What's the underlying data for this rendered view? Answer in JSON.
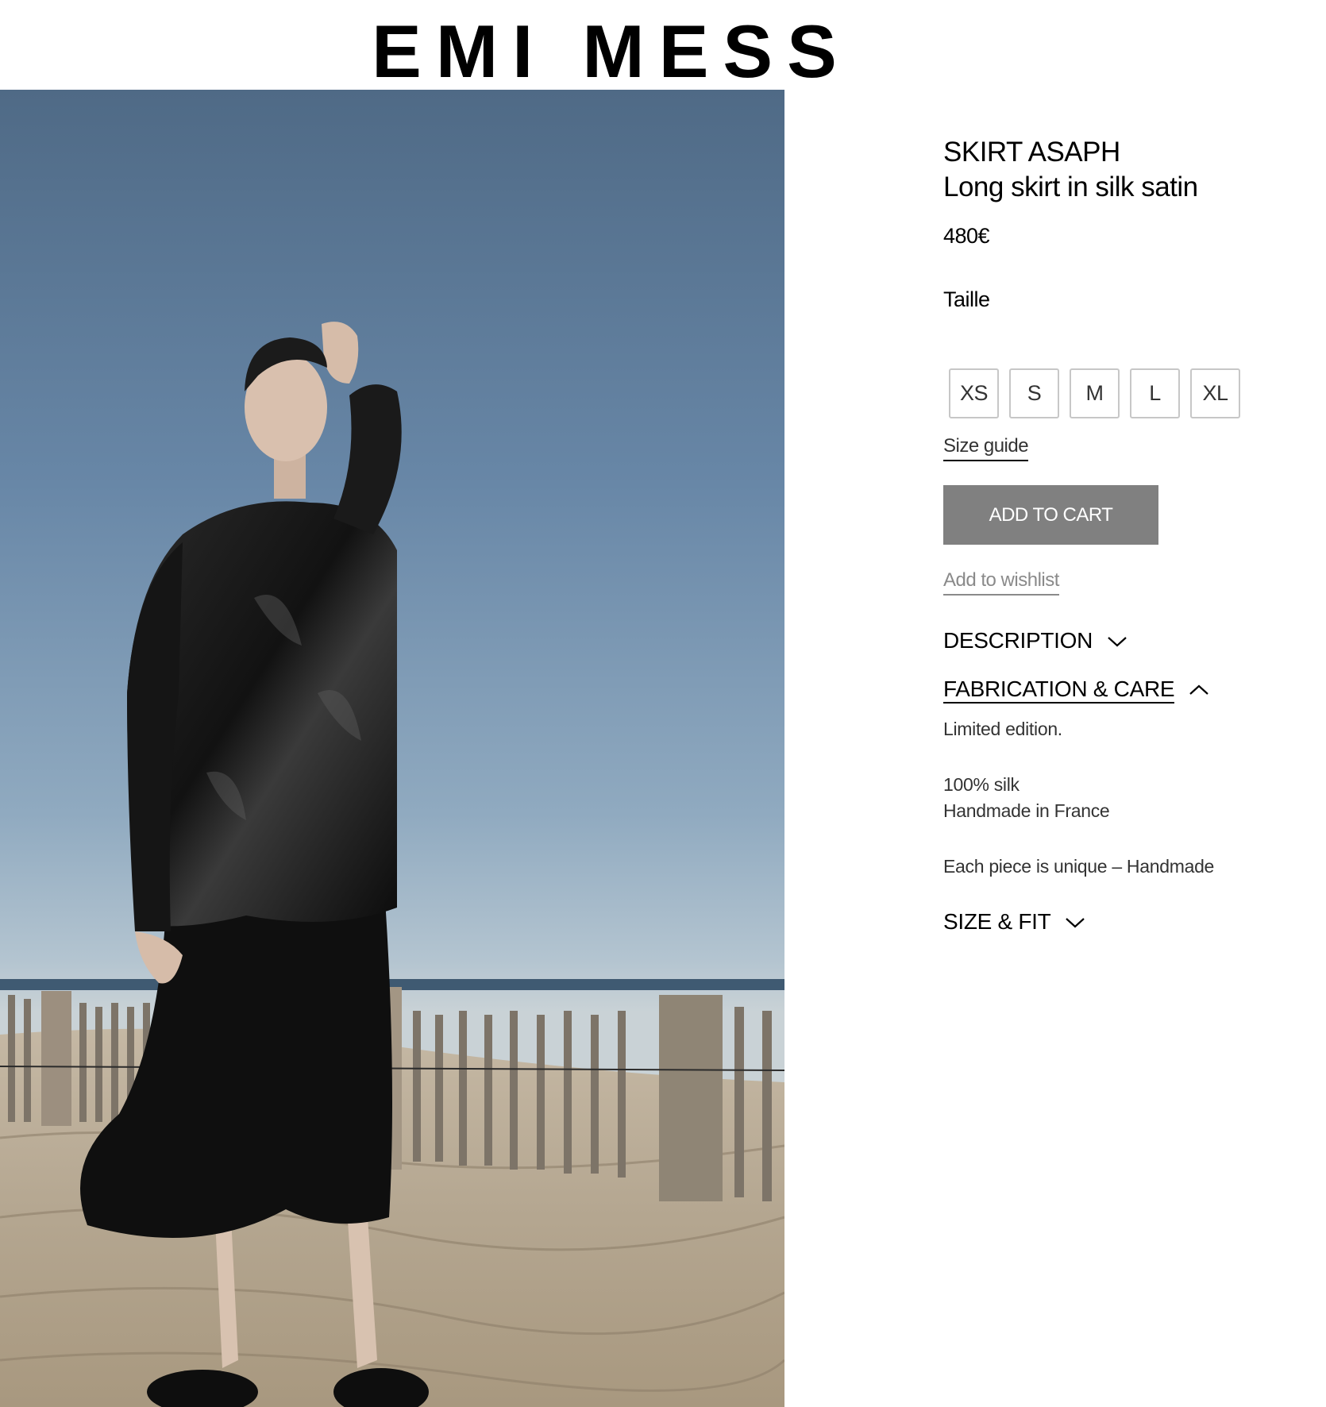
{
  "header": {
    "logo": "EMI MESS"
  },
  "product": {
    "name": "SKIRT ASAPH",
    "subtitle": "Long skirt in silk satin",
    "price": "480€",
    "size_label": "Taille",
    "sizes": [
      "XS",
      "S",
      "M",
      "L",
      "XL"
    ],
    "size_guide": "Size guide",
    "add_to_cart": "ADD TO CART",
    "wishlist": "Add to wishlist"
  },
  "accordion": {
    "description": {
      "title": "DESCRIPTION",
      "expanded": false
    },
    "fabrication": {
      "title": "FABRICATION & CARE",
      "expanded": true,
      "line1": "Limited edition.",
      "line2": "100% silk",
      "line3": "Handmade in France",
      "line4": "Each piece is unique – Handmade"
    },
    "size_fit": {
      "title": "SIZE & FIT",
      "expanded": false
    }
  },
  "icons": {
    "collapsed": "chevron-down-icon",
    "expanded": "chevron-up-icon"
  },
  "colors": {
    "button_bg": "#808080",
    "sky_top": "#4f6a86",
    "sand": "#b9ab96"
  }
}
